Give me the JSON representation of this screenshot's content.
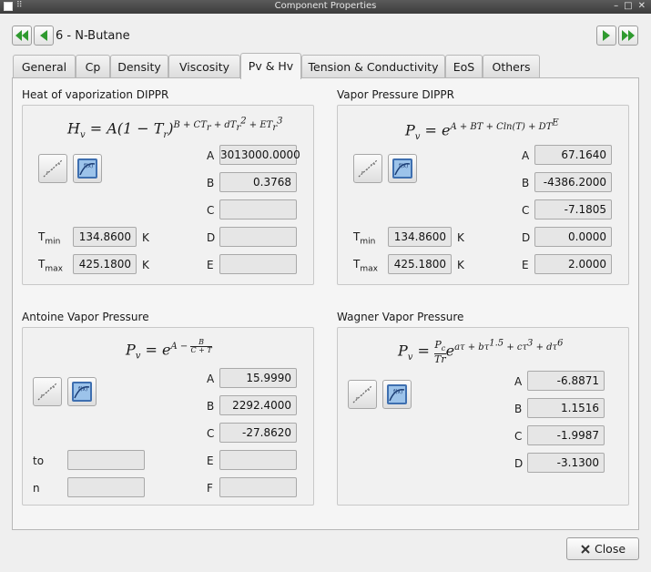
{
  "window": {
    "title": "Component Properties"
  },
  "component": {
    "name": "6 - N-Butane"
  },
  "tabs": [
    {
      "label": "General",
      "active": false
    },
    {
      "label": "Cp",
      "active": false
    },
    {
      "label": "Density",
      "active": false
    },
    {
      "label": "Viscosity",
      "active": false
    },
    {
      "label": "Pv & Hv",
      "active": true
    },
    {
      "label": "Tension & Conductivity",
      "active": false
    },
    {
      "label": "EoS",
      "active": false
    },
    {
      "label": "Others",
      "active": false
    }
  ],
  "heat_vap": {
    "title": "Heat of vaporization DIPPR",
    "params": [
      {
        "name": "A",
        "value": "3013000.0000"
      },
      {
        "name": "B",
        "value": "0.3768"
      },
      {
        "name": "C",
        "value": ""
      },
      {
        "name": "D",
        "value": ""
      },
      {
        "name": "E",
        "value": ""
      }
    ],
    "tmin": {
      "label": "T",
      "sub": "min",
      "value": "134.8600",
      "unit": "K"
    },
    "tmax": {
      "label": "T",
      "sub": "max",
      "value": "425.1800",
      "unit": "K"
    }
  },
  "vapor_dippr": {
    "title": "Vapor Pressure DIPPR",
    "params": [
      {
        "name": "A",
        "value": "67.1640"
      },
      {
        "name": "B",
        "value": "-4386.2000"
      },
      {
        "name": "C",
        "value": "-7.1805"
      },
      {
        "name": "D",
        "value": "0.0000"
      },
      {
        "name": "E",
        "value": "2.0000"
      }
    ],
    "tmin": {
      "label": "T",
      "sub": "min",
      "value": "134.8600",
      "unit": "K"
    },
    "tmax": {
      "label": "T",
      "sub": "max",
      "value": "425.1800",
      "unit": "K"
    }
  },
  "antoine": {
    "title": "Antoine Vapor Pressure",
    "params": [
      {
        "name": "A",
        "value": "15.9990"
      },
      {
        "name": "B",
        "value": "2292.4000"
      },
      {
        "name": "C",
        "value": "-27.8620"
      },
      {
        "name": "E",
        "value": ""
      },
      {
        "name": "F",
        "value": ""
      }
    ],
    "to": {
      "label": "to",
      "value": ""
    },
    "n": {
      "label": "n",
      "value": ""
    }
  },
  "wagner": {
    "title": "Wagner Vapor Pressure",
    "params": [
      {
        "name": "A",
        "value": "-6.8871"
      },
      {
        "name": "B",
        "value": "1.1516"
      },
      {
        "name": "C",
        "value": "-1.9987"
      },
      {
        "name": "D",
        "value": "-3.1300"
      }
    ]
  },
  "close": {
    "label": "Close"
  },
  "icons": {
    "fit": "curve-fit-icon",
    "plot": "function-plot-icon"
  }
}
